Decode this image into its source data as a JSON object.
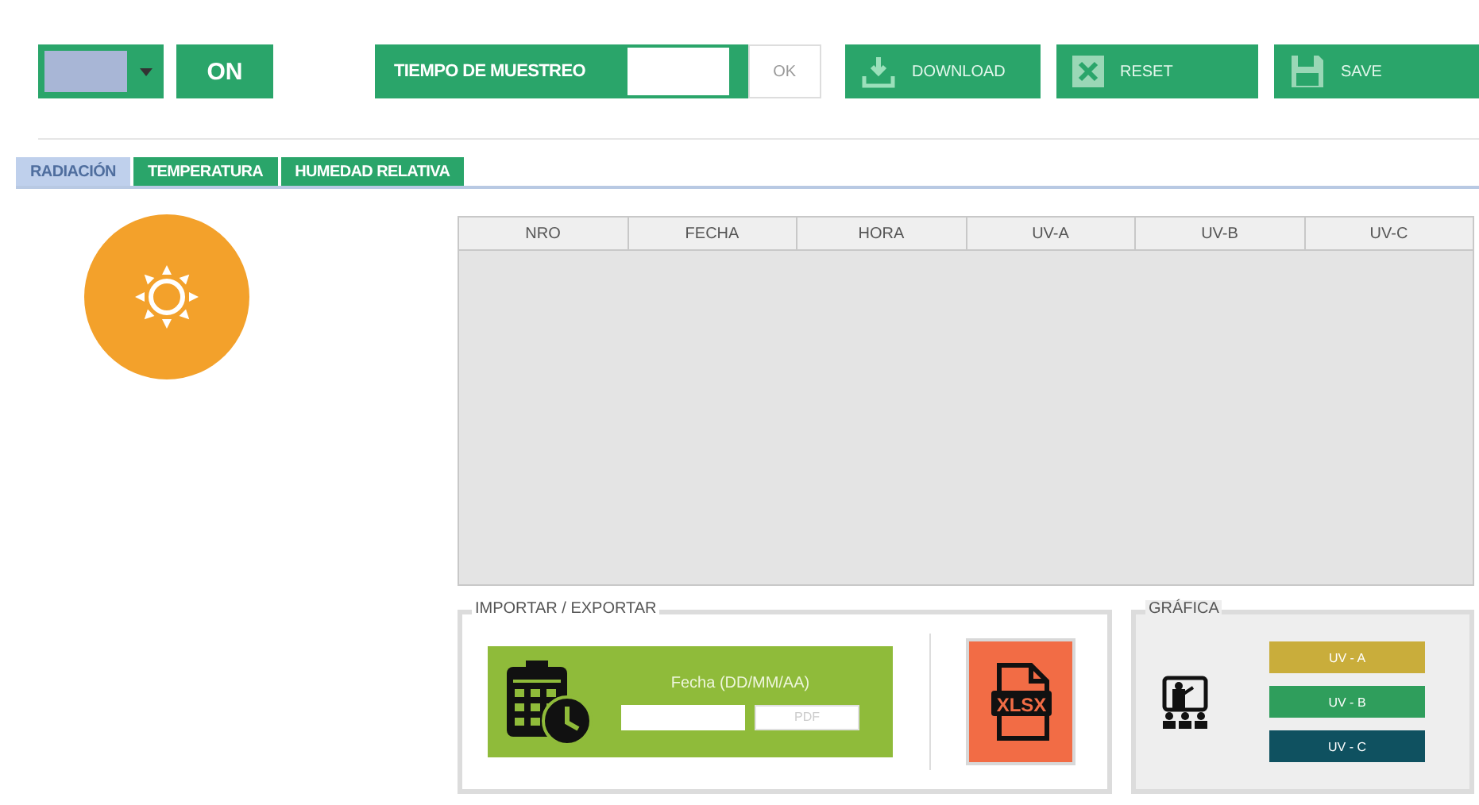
{
  "toolbar": {
    "power_button": "ON",
    "sampling": {
      "label": "TIEMPO DE MUESTREO",
      "ok_button": "OK"
    },
    "actions": [
      {
        "kind": "download",
        "label": "DOWNLOAD",
        "disabled": true
      },
      {
        "kind": "reset",
        "label": "RESET",
        "disabled": true
      },
      {
        "kind": "save",
        "label": "SAVE",
        "disabled": true
      }
    ]
  },
  "tabs": [
    {
      "label": "RADIACIÓN",
      "selected": true
    },
    {
      "label": "TEMPERATURA",
      "selected": false
    },
    {
      "label": "HUMEDAD RELATIVA",
      "selected": false
    }
  ],
  "table": {
    "columns": [
      "NRO",
      "FECHA",
      "HORA",
      "UV-A",
      "UV-B",
      "UV-C"
    ]
  },
  "import_export": {
    "title": "IMPORTAR / EXPORTAR",
    "date_label": "Fecha (DD/MM/AA)",
    "pdf_button": "PDF",
    "xlsx_label": "XLSX"
  },
  "chart_panel": {
    "title": "GRÁFICA",
    "series": [
      {
        "label": "UV - A",
        "color": "#c9ad3b"
      },
      {
        "label": "UV - B",
        "color": "#2f9e5c"
      },
      {
        "label": "UV - C",
        "color": "#0f5160"
      }
    ]
  }
}
